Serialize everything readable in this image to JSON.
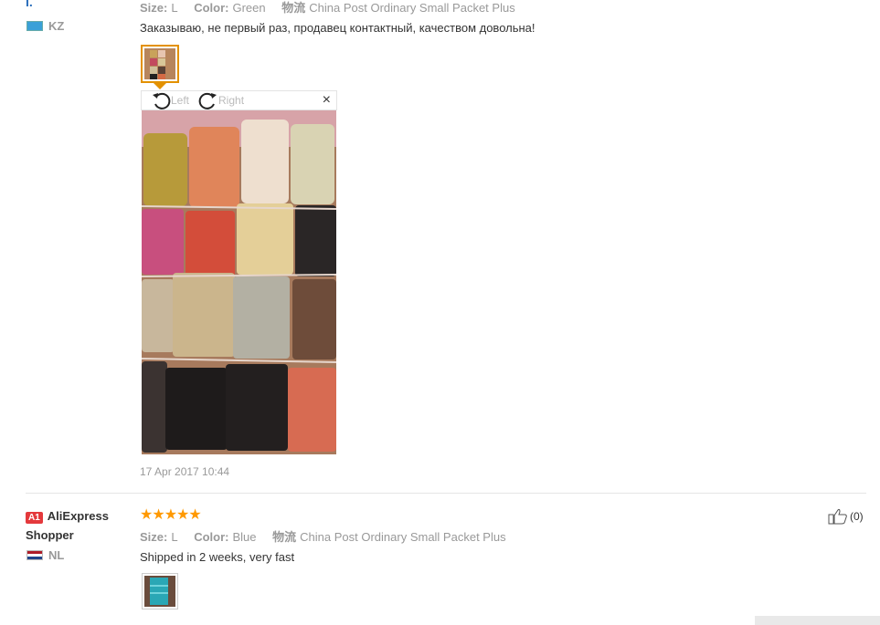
{
  "review1": {
    "name_fragment": "I.",
    "country": "KZ",
    "size_label": "Size:",
    "size_value": "L",
    "color_label": "Color:",
    "color_value": "Green",
    "logistics_label": "物流",
    "logistics_value": "China Post Ordinary Small Packet Plus",
    "text": "Заказываю, не первый раз, продавец контактный, качеством довольна!",
    "viewer": {
      "rotate_left_label": "Left",
      "rotate_right_label": "Right",
      "close_label": "×"
    },
    "date": "17 Apr 2017 10:44"
  },
  "review2": {
    "badge": "A1",
    "name": "AliExpress Shopper",
    "country": "NL",
    "stars": "★★★★★",
    "size_label": "Size:",
    "size_value": "L",
    "color_label": "Color:",
    "color_value": "Blue",
    "logistics_label": "物流",
    "logistics_value": "China Post Ordinary Small Packet Plus",
    "text": "Shipped in 2 weeks, very fast",
    "helpful_count": "(0)"
  },
  "colors": {
    "accent_orange": "#e39100",
    "star": "#ff9900",
    "badge_red": "#e4393c"
  }
}
